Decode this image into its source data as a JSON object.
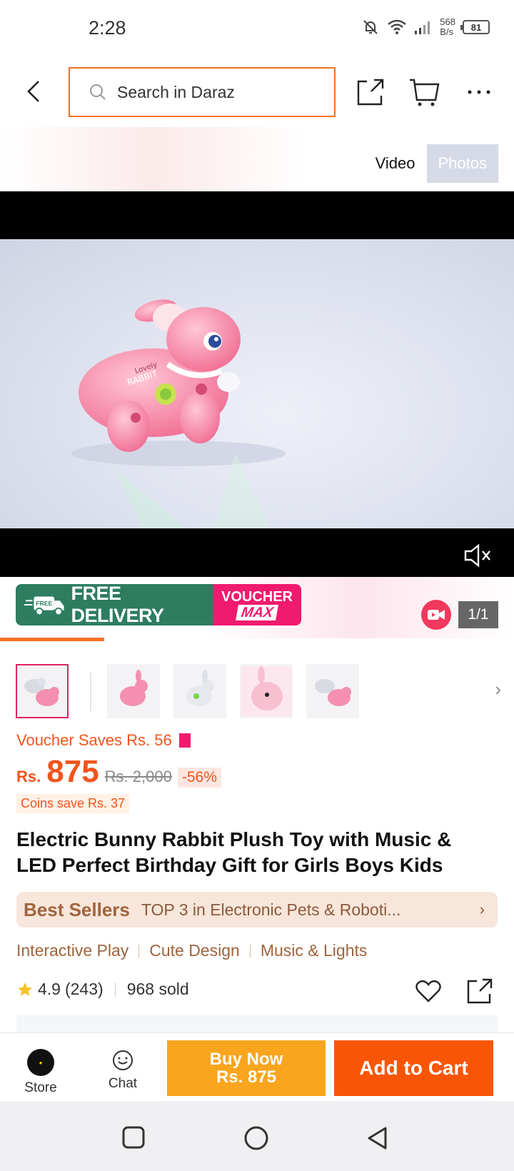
{
  "status_bar": {
    "time": "2:28",
    "net_speed_value": "568",
    "net_speed_unit": "B/s",
    "battery": "81"
  },
  "header": {
    "search_placeholder": "Search in Daraz"
  },
  "media": {
    "tab_video": "Video",
    "tab_photos": "Photos",
    "counter": "1/1"
  },
  "promo": {
    "free_delivery": "FREE DELIVERY",
    "free_small": "FREE",
    "voucher": "VOUCHER",
    "max": "MAX"
  },
  "product": {
    "voucher_saves": "Voucher Saves Rs. 56",
    "currency": "Rs.",
    "price": "875",
    "original_price": "Rs. 2,000",
    "discount": "-56%",
    "coins_save": "Coins save Rs. 37",
    "title": "Electric Bunny Rabbit Plush Toy with Music & LED Perfect Birthday Gift for Girls Boys Kids",
    "best_sellers_label": "Best Sellers",
    "best_sellers_rank": "TOP 3 in Electronic Pets & Roboti...",
    "tags": [
      "Interactive Play",
      "Cute Design",
      "Music & Lights"
    ],
    "rating": "4.9",
    "reviews": "(243)",
    "sold": "968 sold"
  },
  "toy_label": {
    "line1": "Lovely",
    "line2": "RABBIT"
  },
  "actions": {
    "store": "Store",
    "chat": "Chat",
    "buy_now": "Buy Now",
    "buy_now_price": "Rs. 875",
    "add_to_cart": "Add to Cart"
  },
  "colors": {
    "accent": "#f57224",
    "price": "#f2541b",
    "buy_now": "#f9a51e",
    "add_to_cart": "#f85606"
  }
}
